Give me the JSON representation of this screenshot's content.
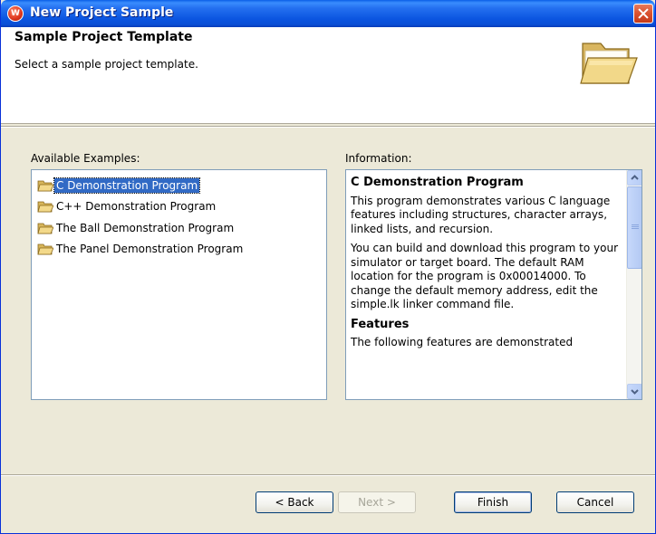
{
  "window": {
    "title": "New Project Sample",
    "app_icon": "wind-river-logo-icon"
  },
  "header": {
    "title": "Sample Project Template",
    "description": "Select a sample project template.",
    "icon": "open-folder-icon"
  },
  "examples": {
    "label": "Available Examples:",
    "items": [
      {
        "label": "C Demonstration Program",
        "selected": true
      },
      {
        "label": "C++ Demonstration Program",
        "selected": false
      },
      {
        "label": "The Ball Demonstration Program",
        "selected": false
      },
      {
        "label": "The Panel Demonstration Program",
        "selected": false
      }
    ]
  },
  "information": {
    "label": "Information:",
    "heading": "C Demonstration Program",
    "paragraph1": "This program demonstrates various C language features including structures, character arrays, linked lists, and recursion.",
    "paragraph2": "You can build and download this program to your simulator or target board. The default RAM location for the program is 0x00014000. To change the default memory address, edit the simple.lk linker command file.",
    "features_heading": "Features",
    "features_text": "The following features are demonstrated"
  },
  "buttons": {
    "back": "< Back",
    "next": "Next >",
    "finish": "Finish",
    "cancel": "Cancel"
  }
}
